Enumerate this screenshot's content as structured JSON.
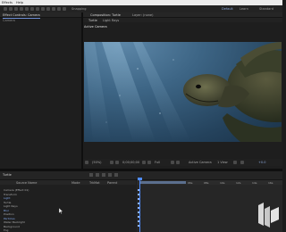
{
  "menubar": {
    "item1": "Effects",
    "item2": "Help"
  },
  "toolbar": {
    "snapping_label": "Snapping",
    "workspace_right1": "Default",
    "workspace_right2": "Learn",
    "workspace_right3": "Standard"
  },
  "project_panel": {
    "tab_label": "Effect Controls: Camera",
    "sub_label": "Camera"
  },
  "comp_panel": {
    "tab_label": "Composition: Turtle",
    "tab2_label": "Layer: (none)",
    "sub_tab1": "Turtle",
    "sub_tab2": "Light Rays",
    "view_label": "Active Camera"
  },
  "viewer_controls": {
    "zoom": "(50%)",
    "timecode": "0;00;00;00",
    "resolution": "Full",
    "camera": "Active Camera",
    "views": "1 View",
    "offset": "+0.0"
  },
  "timeline": {
    "comp_tab": "Turtle",
    "col_source": "Source Name",
    "col_mode": "Mode",
    "col_trk": "TrkMat",
    "col_parent": "Parent",
    "ruler": [
      "0s",
      "02s",
      "04s",
      "06s",
      "08s",
      "10s",
      "12s",
      "14s",
      "16s"
    ],
    "layers": [
      {
        "label": "Camera (Effect 01)",
        "blue": false
      },
      {
        "label": "Transform",
        "blue": false
      },
      {
        "label": "Light",
        "blue": true
      },
      {
        "label": "Turtle",
        "blue": false
      },
      {
        "label": "Light Rays",
        "blue": false
      },
      {
        "label": "Blur",
        "blue": true
      },
      {
        "label": "Position",
        "blue": false
      },
      {
        "label": "Particles",
        "blue": true
      },
      {
        "label": "Water Backlight",
        "blue": false
      },
      {
        "label": "Background",
        "blue": false
      },
      {
        "label": "Fog",
        "blue": false
      }
    ]
  },
  "colors": {
    "accent": "#4f8cff",
    "water": "#3d6585"
  }
}
